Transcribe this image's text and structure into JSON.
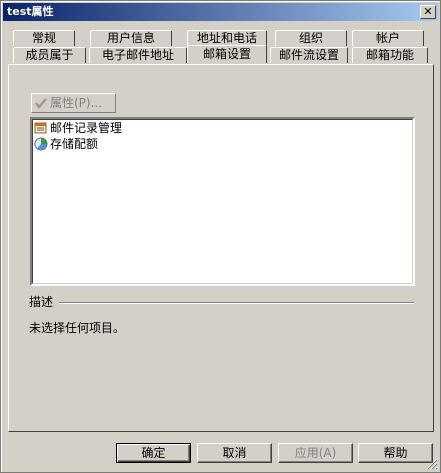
{
  "window": {
    "title": "test属性",
    "close_glyph": "✕"
  },
  "tabs": {
    "row1": [
      "常规",
      "用户信息",
      "地址和电话",
      "组织",
      "帐户"
    ],
    "row2": [
      "成员属于",
      "电子邮件地址",
      "邮箱设置",
      "邮件流设置",
      "邮箱功能"
    ],
    "active": "邮箱设置"
  },
  "panel": {
    "properties_button": "属性(P)...",
    "list_items": [
      {
        "label": "邮件记录管理",
        "icon": "record-management-icon"
      },
      {
        "label": "存储配额",
        "icon": "storage-quota-icon"
      }
    ],
    "description_label": "描述",
    "description_text": "未选择任何项目。"
  },
  "buttons": {
    "ok": "确定",
    "cancel": "取消",
    "apply": "应用(A)",
    "help": "帮助"
  },
  "colors": {
    "face": "#d4d0c8",
    "title_start": "#0a246a",
    "title_end": "#a6caf0",
    "disabled_text": "#808080"
  }
}
